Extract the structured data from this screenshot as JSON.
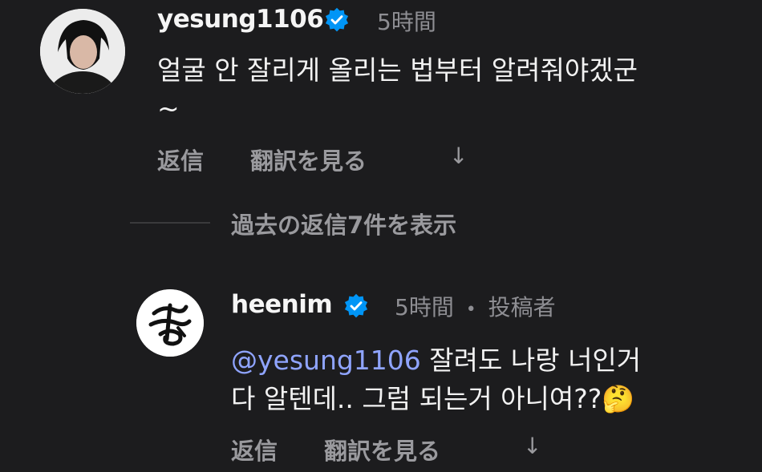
{
  "comment1": {
    "username": "yesung1106",
    "verified_icon": "verified-badge-icon",
    "time": "5時間",
    "text_line1": "얼굴 안 잘리게 올리는 법부터 알려줘야겠군",
    "text_line2": "~",
    "reply_label": "返信",
    "translate_label": "翻訳を見る",
    "expand_icon": "↓"
  },
  "view_replies_label": "過去の返信7件を表示",
  "comment2": {
    "username": "heenim",
    "verified_icon": "verified-badge-icon",
    "time": "5時間",
    "dot": "•",
    "role": "投稿者",
    "mention": "@yesung1106",
    "text_line1_rest": " 잘려도 나랑 너인거",
    "text_line2": "다 알텐데.. 그럼 되는거 아니여??",
    "emoji": "🤔",
    "reply_label": "返信",
    "translate_label": "翻訳を見る",
    "expand_icon": "↓"
  },
  "colors": {
    "background": "#1c1c1e",
    "verified": "#0095f6",
    "mention": "#8fa4ff",
    "secondary_text": "#8e8e93"
  }
}
